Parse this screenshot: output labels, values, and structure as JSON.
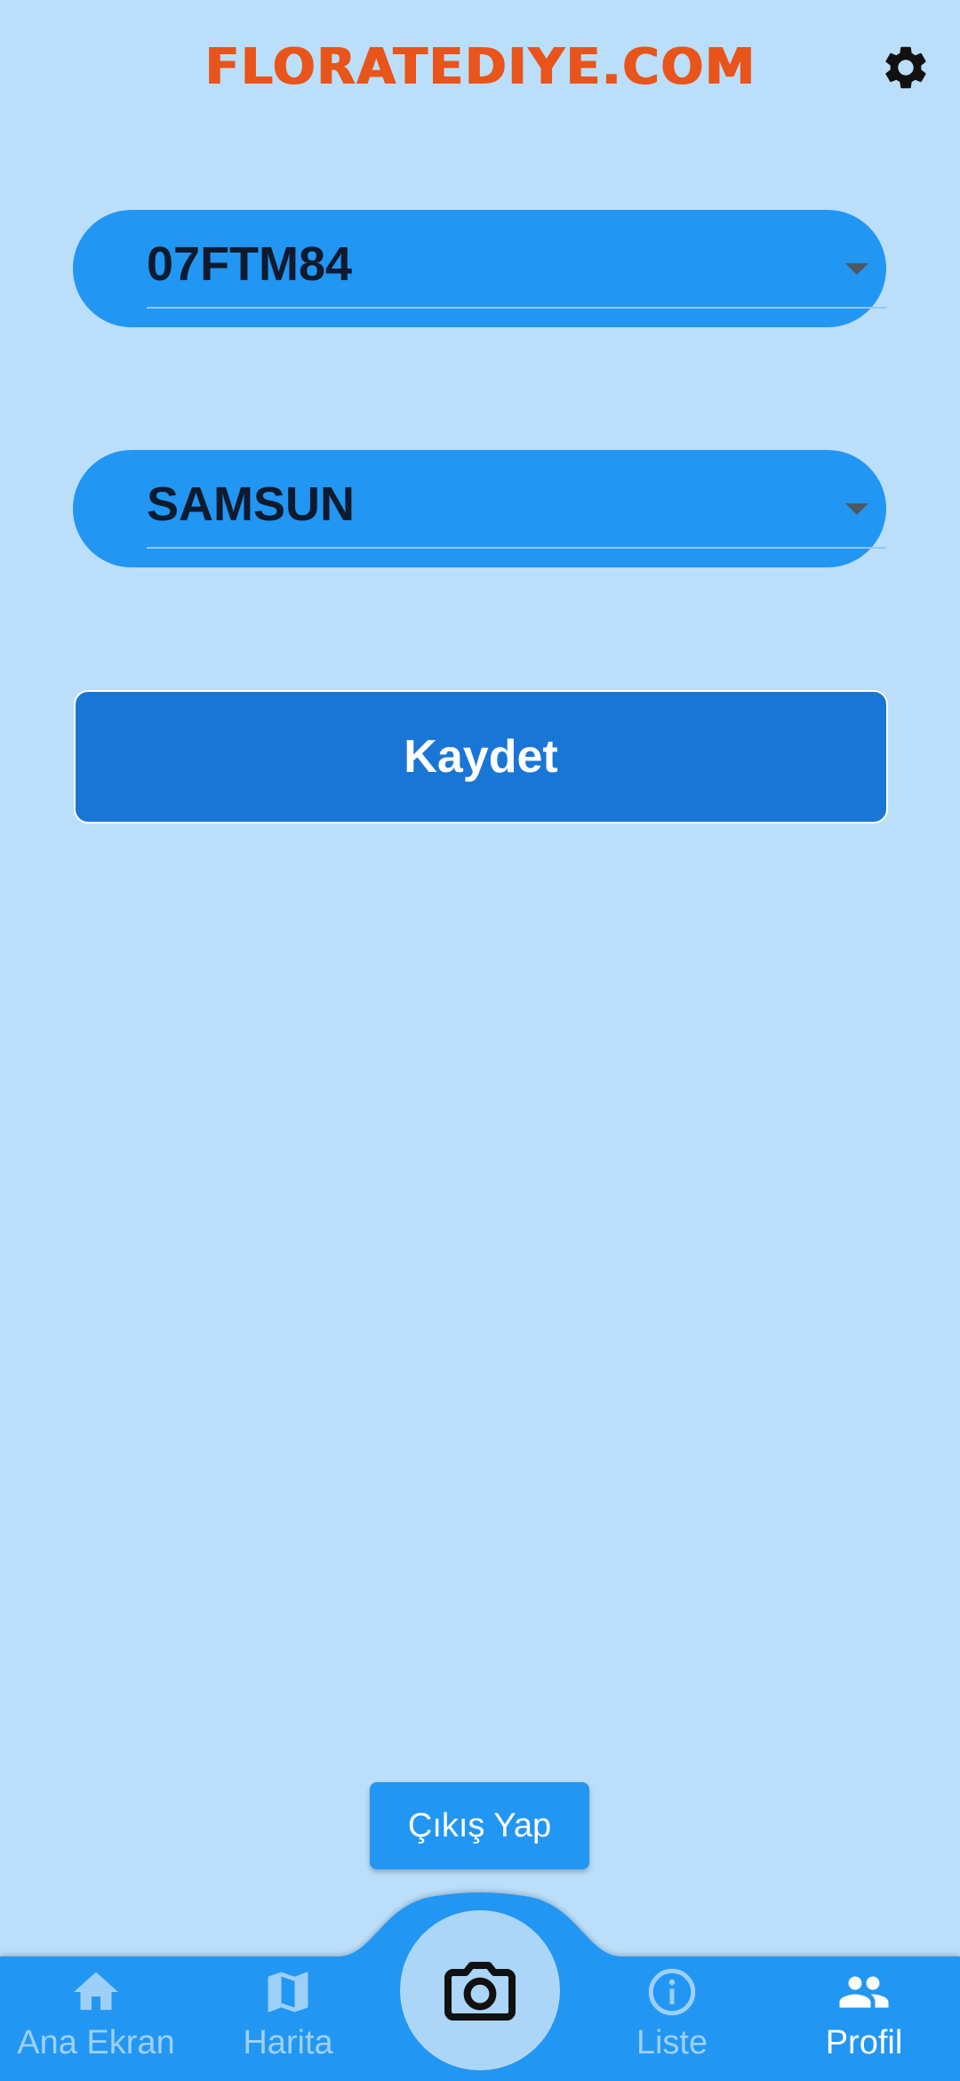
{
  "header": {
    "title": "FLORATEDIYE.COM",
    "settings_icon": "gear-icon"
  },
  "form": {
    "plate_select": {
      "value": "07FTM84"
    },
    "city_select": {
      "value": "SAMSUN"
    },
    "save_label": "Kaydet"
  },
  "logout_label": "Çıkış Yap",
  "bottom_nav": {
    "items": [
      {
        "label": "Ana Ekran",
        "icon": "home-icon"
      },
      {
        "label": "Harita",
        "icon": "map-icon"
      },
      {
        "label": "Liste",
        "icon": "info-icon"
      },
      {
        "label": "Profil",
        "icon": "people-icon",
        "active": true
      }
    ],
    "center_icon": "camera-icon"
  },
  "colors": {
    "background": "#BBDEFA",
    "primary": "#2196F3",
    "primary_dark": "#1976D6",
    "brand": "#E8541A",
    "nav_inactive": "#9DD0F8"
  }
}
